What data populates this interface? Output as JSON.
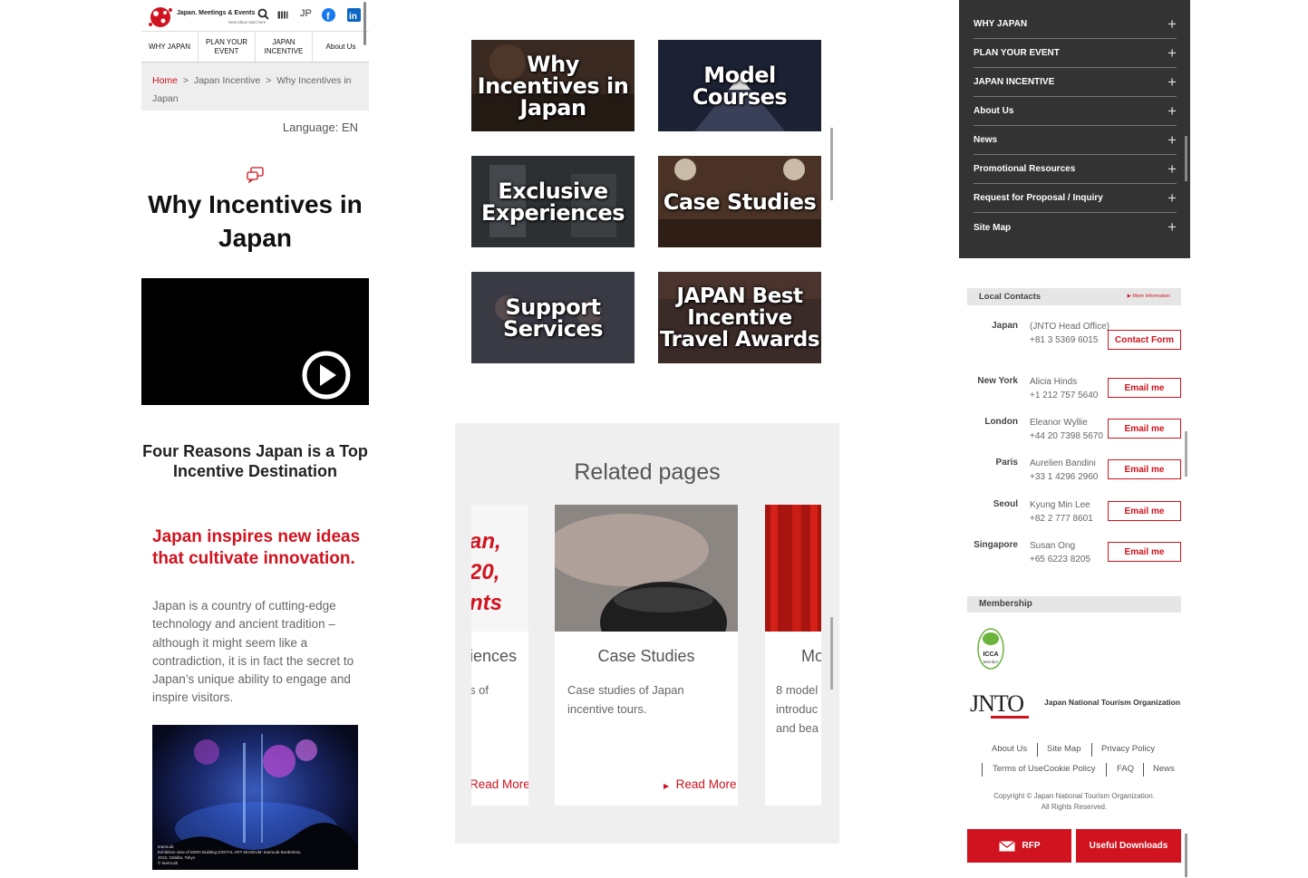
{
  "header": {
    "logo_text": "Japan. Meetings & Events",
    "logo_sub": "New ideas start here",
    "lang_toggle": "JP"
  },
  "nav": [
    "WHY JAPAN",
    "PLAN YOUR EVENT",
    "JAPAN INCENTIVE",
    "About Us"
  ],
  "breadcrumb": {
    "home": "Home",
    "sep": ">",
    "level1": "Japan Incentive",
    "current": "Why Incentives in Japan"
  },
  "language_label": "Language: EN",
  "page_title": "Why Incentives in Japan",
  "section_title": "Four Reasons Japan is a Top Incentive Destination",
  "red_heading": "Japan inspires new ideas that cultivate innovation.",
  "paragraph": "Japan is a country of cutting-edge technology and ancient tradition – although it might seem like a contradiction, it is in fact the secret to Japan’s unique ability to engage and inspire visitors.",
  "photo_caption": "teamLab\nExhibition view of MORI Building DIGITAL ART MUSEUM: teamLab Borderless, 2018, Odaiba, Tokyo\n© teamLab",
  "tiles": [
    {
      "label": "Why Incentives in Japan",
      "bg": "#3a2a22"
    },
    {
      "label": "Model Courses",
      "bg": "#1c2233"
    },
    {
      "label": "Exclusive Experiences",
      "bg": "#2d3033"
    },
    {
      "label": "Case Studies",
      "bg": "#4a3326"
    },
    {
      "label": "Support Services",
      "bg": "#3a3a44"
    },
    {
      "label": "JAPAN Best Incentive Travel Awards",
      "bg": "#3b2b28"
    }
  ],
  "related": {
    "heading": "Related pages",
    "cards": [
      {
        "title": "iences",
        "desc": "s of",
        "read_more": "Read More",
        "img_text": "an,\n20,\nnts"
      },
      {
        "title": "Case Studies",
        "desc": "Case studies of Japan incentive tours.",
        "read_more": "Read More"
      },
      {
        "title": "Mo",
        "desc": "8 model\nintroduc\nand bea",
        "read_more": ""
      }
    ]
  },
  "menu": [
    "WHY JAPAN",
    "PLAN YOUR EVENT",
    "JAPAN INCENTIVE",
    "About Us",
    "News",
    "Promotional Resources",
    "Request for Proposal / Inquiry",
    "Site Map"
  ],
  "local_contacts": {
    "heading": "Local Contacts",
    "more": "More Information",
    "rows": [
      {
        "city": "Japan",
        "info": "(JNTO Head Office)\n+81 3 5369 6015",
        "button": "Contact Form"
      },
      {
        "city": "New York",
        "info": "Alicia Hinds\n+1 212 757 5640",
        "button": "Email me"
      },
      {
        "city": "London",
        "info": "Eleanor Wyllie\n+44 20 7398 5670",
        "button": "Email me"
      },
      {
        "city": "Paris",
        "info": "Aurelien Bandini\n+33 1 4296 2960",
        "button": "Email me"
      },
      {
        "city": "Seoul",
        "info": "Kyung Min Lee\n+82 2 777 8601",
        "button": "Email me"
      },
      {
        "city": "Singapore",
        "info": "Susan Ong\n+65 6223 8205",
        "button": "Email me"
      }
    ]
  },
  "membership": {
    "heading": "Membership",
    "badge": "ICCA Member"
  },
  "jnto": {
    "logo": "JNTO",
    "name": "Japan National Tourism Organization"
  },
  "footer_links": [
    "About Us",
    "Site Map",
    "Privacy Policy",
    "Terms of UseCookie Policy",
    "FAQ",
    "News"
  ],
  "copyright": "Copyright © Japan National Tourism Organization.\nAll Rights Reserved.",
  "bottom_buttons": {
    "rfp": "RFP",
    "downloads": "Useful Downloads"
  },
  "colors": {
    "brand_red": "#d0131f",
    "menu_bg": "#333333"
  }
}
